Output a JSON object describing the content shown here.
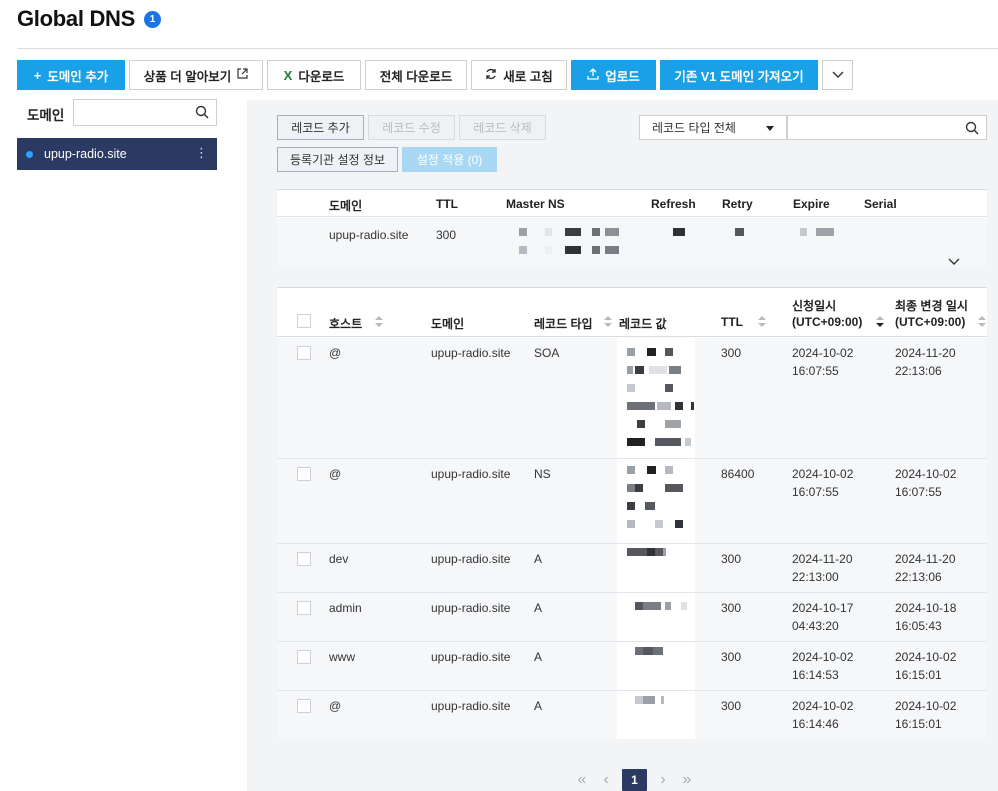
{
  "header": {
    "title": "Global DNS",
    "badge": "1"
  },
  "toolbar": {
    "add_domain": "도메인 추가",
    "learn_more": "상품 더 알아보기",
    "download": "다운로드",
    "download_all": "전체 다운로드",
    "refresh": "새로 고침",
    "upload": "업로드",
    "import_v1": "기존 V1 도메인 가져오기"
  },
  "sidebar": {
    "label": "도메인",
    "search_placeholder": "",
    "items": [
      {
        "label": "upup-radio.site"
      }
    ]
  },
  "actions": {
    "add_record": "레코드 추가",
    "edit_record": "레코드 수정",
    "delete_record": "레코드 삭제",
    "registrar_info": "등록기관 설정 정보",
    "apply_settings": "설정 적용 (0)"
  },
  "filter": {
    "record_type": "레코드 타입 전체",
    "search_placeholder": ""
  },
  "soa": {
    "headers": {
      "domain": "도메인",
      "ttl": "TTL",
      "master_ns": "Master NS",
      "refresh": "Refresh",
      "retry": "Retry",
      "expire": "Expire",
      "serial": "Serial"
    },
    "row": {
      "domain": "upup-radio.site",
      "ttl": "300"
    }
  },
  "records": {
    "headers": {
      "host": "호스트",
      "domain": "도메인",
      "type": "레코드 타입",
      "value": "레코드 값",
      "ttl": "TTL",
      "created_l1": "신청일시",
      "created_l2": "(UTC+09:00)",
      "modified_l1": "최종 변경 일시",
      "modified_l2": "(UTC+09:00)"
    },
    "rows": [
      {
        "host": "@",
        "domain": "upup-radio.site",
        "type": "SOA",
        "ttl": "300",
        "created_date": "2024-10-02",
        "created_time": "16:07:55",
        "modified_date": "2024-11-20",
        "modified_time": "22:13:06"
      },
      {
        "host": "@",
        "domain": "upup-radio.site",
        "type": "NS",
        "ttl": "86400",
        "created_date": "2024-10-02",
        "created_time": "16:07:55",
        "modified_date": "2024-10-02",
        "modified_time": "16:07:55"
      },
      {
        "host": "dev",
        "domain": "upup-radio.site",
        "type": "A",
        "ttl": "300",
        "created_date": "2024-11-20",
        "created_time": "22:13:00",
        "modified_date": "2024-11-20",
        "modified_time": "22:13:06"
      },
      {
        "host": "admin",
        "domain": "upup-radio.site",
        "type": "A",
        "ttl": "300",
        "created_date": "2024-10-17",
        "created_time": "04:43:20",
        "modified_date": "2024-10-18",
        "modified_time": "16:05:43"
      },
      {
        "host": "www",
        "domain": "upup-radio.site",
        "type": "A",
        "ttl": "300",
        "created_date": "2024-10-02",
        "created_time": "16:14:53",
        "modified_date": "2024-10-02",
        "modified_time": "16:15:01"
      },
      {
        "host": "@",
        "domain": "upup-radio.site",
        "type": "A",
        "ttl": "300",
        "created_date": "2024-10-02",
        "created_time": "16:14:46",
        "modified_date": "2024-10-02",
        "modified_time": "16:15:01"
      }
    ]
  },
  "pagination": {
    "current": "1"
  },
  "colors": {
    "primary": "#1aa0e6",
    "navy": "#2b3a63",
    "badge": "#1a73e8",
    "excel": "#1e7e34"
  }
}
